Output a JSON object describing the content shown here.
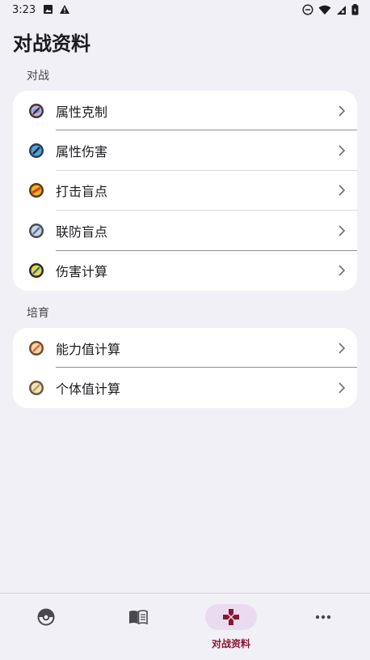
{
  "status_bar": {
    "time": "3:23",
    "left_icons": [
      "photo-icon",
      "warning-icon"
    ],
    "right_icons": [
      "do-not-disturb-icon",
      "wifi-icon",
      "signal-icon",
      "battery-icon"
    ]
  },
  "page": {
    "title": "对战资料"
  },
  "sections": [
    {
      "header": "对战",
      "items": [
        {
          "label": "属性克制",
          "icon": "type-effectiveness-icon"
        },
        {
          "label": "属性伤害",
          "icon": "type-damage-icon"
        },
        {
          "label": "打击盲点",
          "icon": "coverage-blindspot-icon"
        },
        {
          "label": "联防盲点",
          "icon": "defense-blindspot-icon"
        },
        {
          "label": "伤害计算",
          "icon": "damage-calculator-icon"
        }
      ]
    },
    {
      "header": "培育",
      "items": [
        {
          "label": "能力值计算",
          "icon": "stat-calculator-icon"
        },
        {
          "label": "个体值计算",
          "icon": "iv-calculator-icon"
        }
      ]
    }
  ],
  "bottom_nav": {
    "items": [
      {
        "icon": "pokeball-icon",
        "label": ""
      },
      {
        "icon": "book-icon",
        "label": ""
      },
      {
        "icon": "gamepad-icon",
        "label": "对战资料",
        "active": true
      },
      {
        "icon": "more-icon",
        "label": ""
      }
    ]
  },
  "colors": {
    "background": "#f1f0f6",
    "card": "#ffffff",
    "accent": "#8b1533",
    "active_indicator": "#eadcf0"
  }
}
